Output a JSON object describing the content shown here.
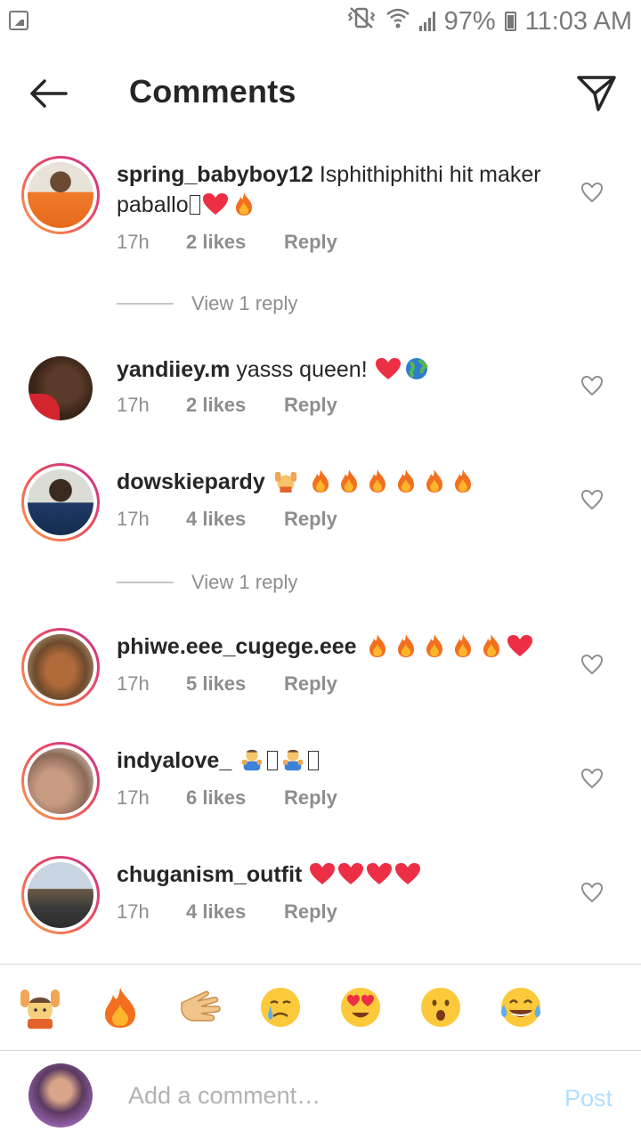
{
  "status_bar": {
    "battery_percent": "97%",
    "time": "11:03 AM"
  },
  "header": {
    "title": "Comments",
    "back_icon": "arrow-left-icon",
    "send_icon": "paper-plane-icon"
  },
  "comments": [
    {
      "username": "spring_babyboy12",
      "text": "Isphithiphithi hit maker paballo",
      "time": "17h",
      "likes": "2 likes",
      "reply_label": "Reply",
      "has_story_ring": true
    },
    {
      "username": "yandiiey.m",
      "text": "yasss queen!",
      "time": "17h",
      "likes": "2 likes",
      "reply_label": "Reply",
      "has_story_ring": false
    },
    {
      "username": "dowskiepardy",
      "text": "",
      "time": "17h",
      "likes": "4 likes",
      "reply_label": "Reply",
      "has_story_ring": true
    },
    {
      "username": "phiwe.eee_cugege.eee",
      "text": "",
      "time": "17h",
      "likes": "5 likes",
      "reply_label": "Reply",
      "has_story_ring": true
    },
    {
      "username": "indyalove_",
      "text": "",
      "time": "17h",
      "likes": "6 likes",
      "reply_label": "Reply",
      "has_story_ring": true
    },
    {
      "username": "chuganism_outfit",
      "text": "",
      "time": "17h",
      "likes": "4 likes",
      "reply_label": "Reply",
      "has_story_ring": true
    }
  ],
  "view_replies": [
    {
      "label": "View 1 reply"
    },
    {
      "label": "View 1 reply"
    }
  ],
  "quick_emojis": [
    "raising-hands",
    "fire",
    "clapping-hands",
    "crying-face",
    "heart-eyes",
    "surprised-face",
    "tears-of-joy"
  ],
  "composer": {
    "placeholder": "Add a comment…",
    "post_label": "Post"
  },
  "colors": {
    "text": "#262626",
    "secondary": "#8e8e8e",
    "post_disabled": "#b2dffc",
    "heart": "#ed2f45",
    "fire": "#f36f1f",
    "story_ring_start": "#f9a34d",
    "story_ring_end": "#c62e90"
  }
}
